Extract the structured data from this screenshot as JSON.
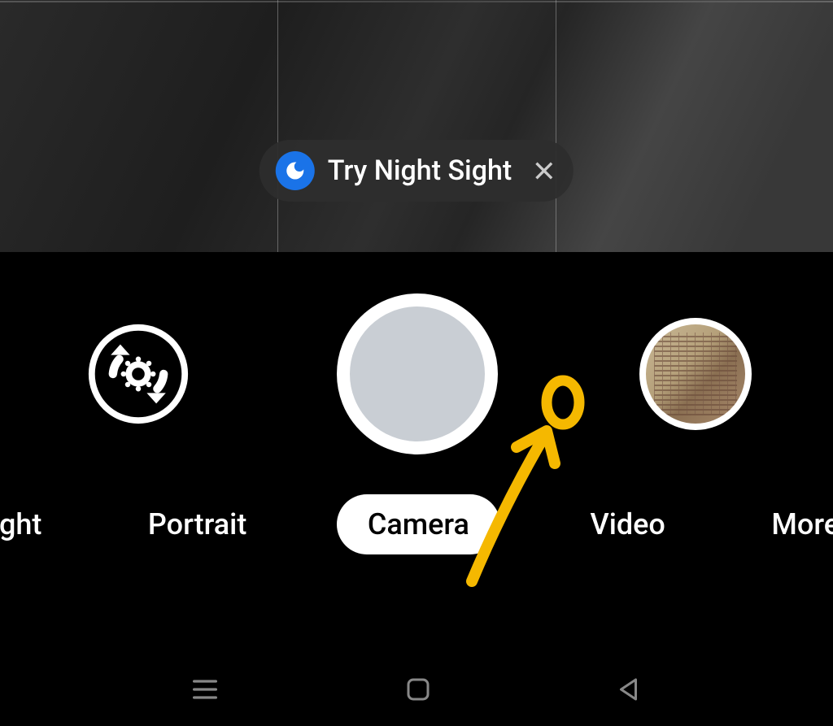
{
  "suggestion": {
    "label": "Try Night Sight"
  },
  "modes": {
    "sight": "Sight",
    "portrait": "Portrait",
    "camera": "Camera",
    "video": "Video",
    "more": "More"
  }
}
